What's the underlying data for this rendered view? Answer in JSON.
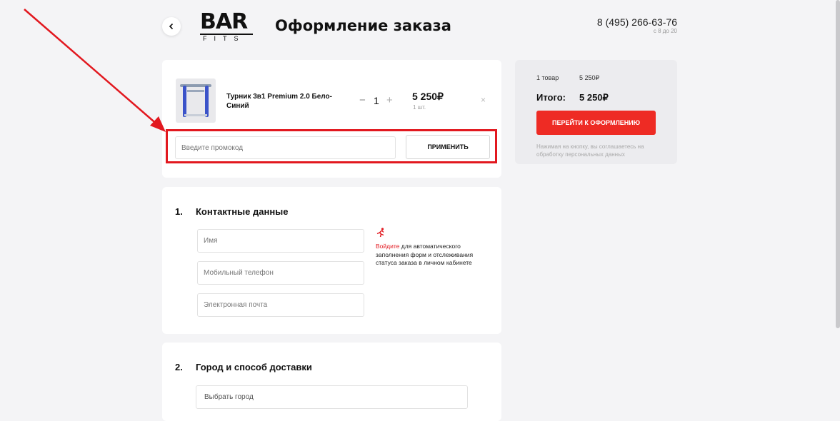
{
  "header": {
    "back_icon": "chevron-left-icon",
    "logo_top": "BAR",
    "logo_bottom": "FITS",
    "title": "Оформление заказа",
    "phone": "8 (495) 266-63-76",
    "hours": "с 8 до 20"
  },
  "cart": {
    "item": {
      "name": "Турник 3в1 Premium 2.0 Бело-Синий",
      "qty_minus": "−",
      "qty": "1",
      "qty_plus": "+",
      "price": "5 250₽",
      "unit": "1 шт.",
      "remove": "×"
    },
    "promo": {
      "placeholder": "Введите промокод",
      "apply_label": "ПРИМЕНИТЬ"
    }
  },
  "summary": {
    "count": "1 товар",
    "subtotal": "5 250₽",
    "total_label": "Итого:",
    "total_value": "5 250₽",
    "checkout_label": "ПЕРЕЙТИ К ОФОРМЛЕНИЮ",
    "consent": "Нажимая на кнопку, вы соглашаетесь на обработку персональных данных"
  },
  "contacts": {
    "number": "1.",
    "title": "Контактные данные",
    "name_placeholder": "Имя",
    "phone_placeholder": "Мобильный телефон",
    "email_placeholder": "Электронная почта",
    "login_link": "Войдите",
    "login_text": " для автоматического заполнения форм и отслеживания статуса заказа в личном кабинете"
  },
  "delivery": {
    "number": "2.",
    "title": "Город и способ доставки",
    "city_placeholder": "Выбрать город"
  },
  "colors": {
    "accent": "#e2181f",
    "button_red": "#ee2b24",
    "background": "#f4f4f6"
  }
}
